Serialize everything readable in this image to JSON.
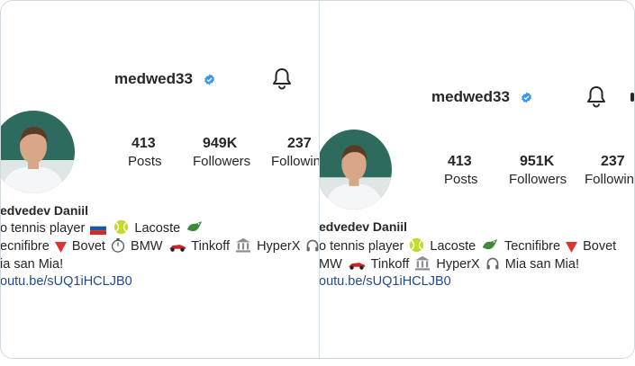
{
  "left": {
    "username": "medwed33",
    "stats": [
      {
        "value": "413",
        "label": "Posts"
      },
      {
        "value": "949K",
        "label": "Followers"
      },
      {
        "value": "237",
        "label": "Followin"
      }
    ],
    "display_name": "edvedev Daniil",
    "bio_line1": [
      "o tennis player",
      "Lacoste"
    ],
    "bio_line2": [
      "ecnifibre",
      "Bovet",
      "BMW",
      "Tinkoff",
      "HyperX"
    ],
    "bio_line3": "ia san Mia!",
    "link": "outu.be/sUQ1iHCLJB0"
  },
  "right": {
    "username": "medwed33",
    "stats": [
      {
        "value": "413",
        "label": "Posts"
      },
      {
        "value": "951K",
        "label": "Followers"
      },
      {
        "value": "237",
        "label": "Followin"
      }
    ],
    "display_name": "edvedev Daniil",
    "bio_line1": [
      "o tennis player",
      "Lacoste",
      "Tecnifibre",
      "Bovet"
    ],
    "bio_line2": [
      "MW",
      "Tinkoff",
      "HyperX",
      "Mia san Mia!"
    ],
    "link": "outu.be/sUQ1iHCLJB0"
  },
  "icons": {
    "verified": "verified-badge-icon",
    "bell": "bell-icon",
    "flag": "russia-flag-icon",
    "tennis": "tennis-ball-icon",
    "croc": "crocodile-icon",
    "triangle": "red-triangle-icon",
    "watch": "stopwatch-icon",
    "car": "race-car-icon",
    "bank": "bank-icon",
    "headphones": "headphones-icon"
  },
  "colors": {
    "verified": "#3897f0",
    "link": "#1f4a8f",
    "border": "#cfd9de"
  }
}
